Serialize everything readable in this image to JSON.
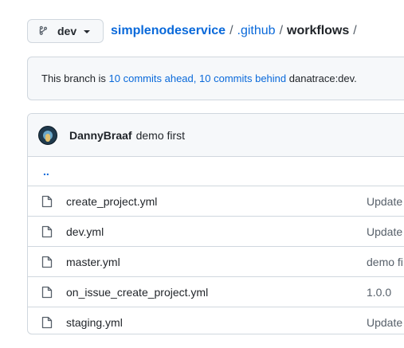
{
  "branch": {
    "name": "dev"
  },
  "breadcrumb": {
    "repo": "simplenodeservice",
    "sep1": "/",
    "folder": ".github",
    "sep2": "/",
    "current": "workflows",
    "sep3": "/"
  },
  "banner": {
    "prefix": "This branch is ",
    "ahead": "10 commits ahead,",
    "space": " ",
    "behind": "10 commits behind",
    "target": " danatrace:dev."
  },
  "latest_commit": {
    "author": "DannyBraaf",
    "message": "demo first"
  },
  "parent_dir": "..",
  "files": [
    {
      "name": "create_project.yml",
      "message": "Update"
    },
    {
      "name": "dev.yml",
      "message": "Update"
    },
    {
      "name": "master.yml",
      "message": "demo fi"
    },
    {
      "name": "on_issue_create_project.yml",
      "message": "1.0.0"
    },
    {
      "name": "staging.yml",
      "message": "Update"
    }
  ]
}
